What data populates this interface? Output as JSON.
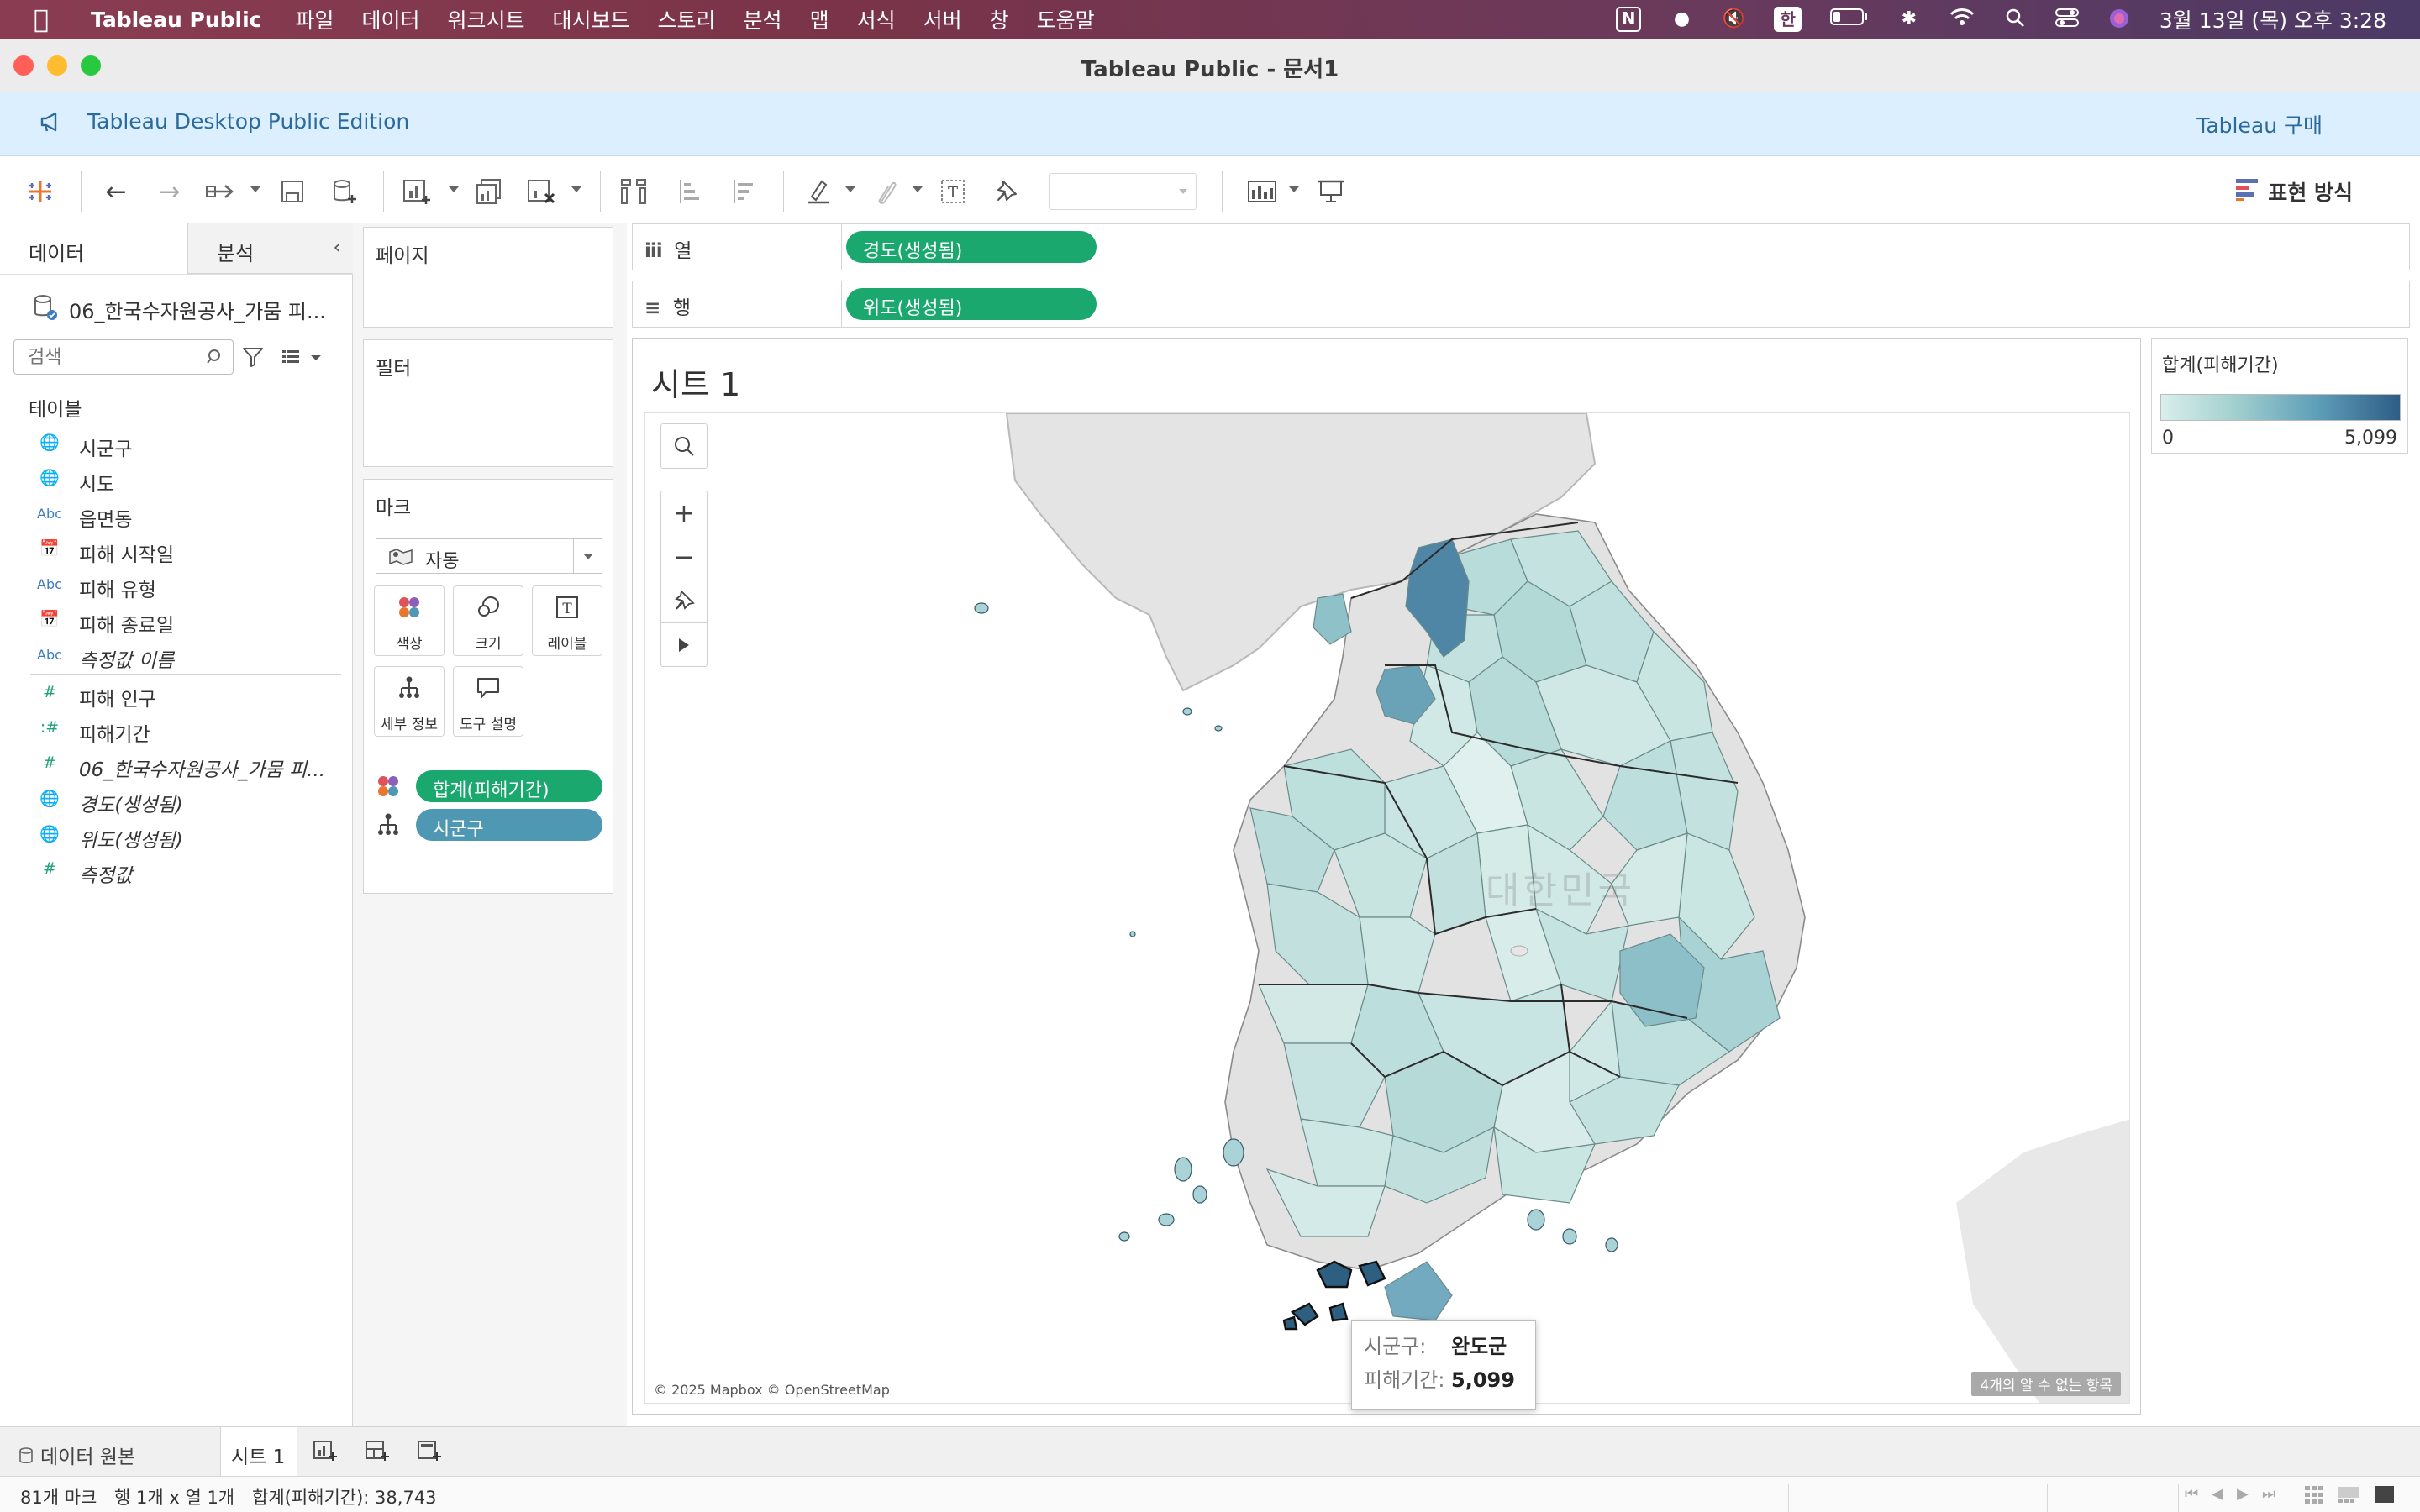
{
  "menubar": {
    "app_name": "Tableau Public",
    "items": [
      "파일",
      "데이터",
      "워크시트",
      "대시보드",
      "스토리",
      "분석",
      "맵",
      "서식",
      "서버",
      "창",
      "도움말"
    ],
    "ime": "한",
    "clock": "3월 13일 (목) 오후 3:28"
  },
  "window": {
    "title": "Tableau Public - 문서1"
  },
  "banner": {
    "edition": "Tableau Desktop Public Edition",
    "buy": "Tableau 구매"
  },
  "toolbar": {
    "show_me": "표현 방식"
  },
  "datapane": {
    "tab_data": "데이터",
    "tab_analysis": "분석",
    "datasource": "06_한국수자원공사_가뭄 피...",
    "search_placeholder": "검색",
    "tables_header": "테이블",
    "fields": [
      {
        "icon": "geo",
        "name": "시군구"
      },
      {
        "icon": "geo",
        "name": "시도"
      },
      {
        "icon": "abc",
        "name": "읍면동"
      },
      {
        "icon": "date",
        "name": "피해 시작일"
      },
      {
        "icon": "abc",
        "name": "피해 유형"
      },
      {
        "icon": "date",
        "name": "피해 종료일"
      },
      {
        "icon": "abc",
        "name": "측정값 이름"
      },
      {
        "icon": "num",
        "name": "피해 인구"
      },
      {
        "icon": "num-bin",
        "name": "피해기간"
      },
      {
        "icon": "num",
        "name": "06_한국수자원공사_가뭄 피..."
      },
      {
        "icon": "geo-green",
        "name": "경도(생성됨)"
      },
      {
        "icon": "geo-green",
        "name": "위도(생성됨)"
      },
      {
        "icon": "num",
        "name": "측정값"
      }
    ]
  },
  "cards": {
    "pages": "페이지",
    "filters": "필터",
    "marks": "마크",
    "mark_type": "자동",
    "mark_buttons": {
      "color": "색상",
      "size": "크기",
      "label": "레이블",
      "detail": "세부 정보",
      "tooltip": "도구 설명"
    },
    "color_pill": "합계(피해기간)",
    "detail_pill": "시군구"
  },
  "shelves": {
    "columns_label": "열",
    "columns_pill": "경도(생성됨)",
    "rows_label": "행",
    "rows_pill": "위도(생성됨)"
  },
  "view": {
    "sheet_title": "시트 1",
    "attribution": "© 2025 Mapbox © OpenStreetMap",
    "unknown_badge": "4개의 알 수 없는 항목",
    "region_label": "대한민국"
  },
  "tooltip": {
    "k1": "시군구:",
    "v1": "완도군",
    "k2": "피해기간:",
    "v2": "5,099"
  },
  "legend": {
    "title": "합계(피해기간)",
    "min": "0",
    "max": "5,099",
    "colors": [
      "#d8eeec",
      "#a4d1cf",
      "#5f9fb9",
      "#2e5d85"
    ]
  },
  "sheettabs": {
    "datasource": "데이터 원본",
    "sheet1": "시트 1"
  },
  "statusbar": {
    "marks": "81개 마크",
    "dims": "행 1개 x 열 1개",
    "sum": "합계(피해기간): 38,743"
  }
}
